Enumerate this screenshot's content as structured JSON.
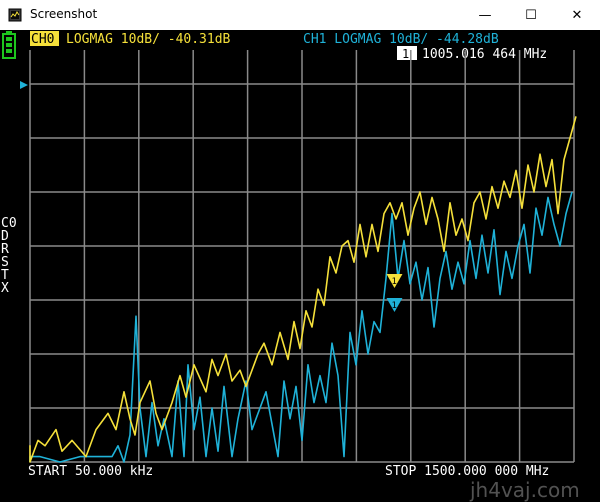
{
  "window": {
    "title": "Screenshot",
    "minimize_glyph": "—",
    "maximize_glyph": "☐",
    "close_glyph": "✕"
  },
  "header": {
    "ch0_tag": "CH0",
    "ch0_info": "LOGMAG 10dB/ -40.31dB",
    "ch1_info": "CH1 LOGMAG 10dB/ -44.28dB",
    "marker_readout": "1005.016 464 MHz",
    "marker_number": "1"
  },
  "side_menu": {
    "items": [
      "C0",
      "D",
      "R",
      "S",
      "T",
      "X"
    ]
  },
  "footer": {
    "start": "START 50.000 kHz",
    "stop": "STOP 1500.000 000 MHz"
  },
  "watermark": "jh4vaj.com",
  "colors": {
    "ch0_trace": "#f5e03a",
    "ch1_trace": "#1fb2d8",
    "grid": "#8a8a8a",
    "battery": "#1ec71e",
    "text": "#ffffff"
  },
  "chart_data": {
    "type": "line",
    "x_start_mhz": 0.05,
    "x_stop_mhz": 1500,
    "y_scale_db_per_div": 10,
    "grid": true,
    "marker": {
      "index": 1,
      "freq_mhz": 1005.016464
    },
    "series": [
      {
        "name": "CH0",
        "color": "#f5e03a",
        "points": [
          [
            3.0,
            7.8
          ],
          [
            12,
            7.9
          ],
          [
            18,
            7.7
          ],
          [
            28,
            8
          ],
          [
            38,
            7.6
          ],
          [
            45,
            7.7
          ],
          [
            56,
            7.4
          ],
          [
            62,
            7.8
          ],
          [
            72,
            7.6
          ],
          [
            86,
            7.9
          ],
          [
            96,
            7.4
          ],
          [
            108,
            7.1
          ],
          [
            116,
            7.4
          ],
          [
            124,
            6.7
          ],
          [
            130,
            7.2
          ],
          [
            135,
            7.5
          ],
          [
            140,
            6.9
          ],
          [
            150,
            6.5
          ],
          [
            156,
            7.1
          ],
          [
            162,
            7.4
          ],
          [
            172,
            6.9
          ],
          [
            180,
            6.4
          ],
          [
            186,
            6.8
          ],
          [
            194,
            6.2
          ],
          [
            206,
            6.7
          ],
          [
            212,
            6.1
          ],
          [
            218,
            6.4
          ],
          [
            226,
            6.0
          ],
          [
            232,
            6.5
          ],
          [
            240,
            6.3
          ],
          [
            246,
            6.6
          ],
          [
            258,
            6.0
          ],
          [
            264,
            5.8
          ],
          [
            272,
            6.2
          ],
          [
            280,
            5.6
          ],
          [
            288,
            6.1
          ],
          [
            294,
            5.4
          ],
          [
            300,
            5.9
          ],
          [
            306,
            5.2
          ],
          [
            312,
            5.5
          ],
          [
            318,
            4.8
          ],
          [
            324,
            5.1
          ],
          [
            330,
            4.2
          ],
          [
            336,
            4.5
          ],
          [
            342,
            4.0
          ],
          [
            348,
            3.9
          ],
          [
            354,
            4.3
          ],
          [
            360,
            3.6
          ],
          [
            366,
            4.2
          ],
          [
            372,
            3.6
          ],
          [
            378,
            4.1
          ],
          [
            384,
            3.4
          ],
          [
            390,
            3.2
          ],
          [
            396,
            3.5
          ],
          [
            402,
            3.2
          ],
          [
            408,
            3.8
          ],
          [
            414,
            3.3
          ],
          [
            420,
            3.0
          ],
          [
            426,
            3.6
          ],
          [
            432,
            3.1
          ],
          [
            438,
            3.5
          ],
          [
            444,
            4.1
          ],
          [
            450,
            3.2
          ],
          [
            456,
            3.8
          ],
          [
            462,
            3.5
          ],
          [
            468,
            3.9
          ],
          [
            474,
            3.2
          ],
          [
            480,
            3.0
          ],
          [
            486,
            3.5
          ],
          [
            492,
            2.9
          ],
          [
            498,
            3.3
          ],
          [
            504,
            2.8
          ],
          [
            510,
            3.1
          ],
          [
            516,
            2.6
          ],
          [
            522,
            3.3
          ],
          [
            528,
            2.5
          ],
          [
            534,
            3.0
          ],
          [
            540,
            2.3
          ],
          [
            546,
            2.9
          ],
          [
            552,
            2.4
          ],
          [
            558,
            3.4
          ],
          [
            564,
            2.4
          ],
          [
            570,
            2.0
          ],
          [
            576,
            1.6
          ]
        ]
      },
      {
        "name": "CH1",
        "color": "#1fb2d8",
        "points": [
          [
            3.0,
            8.0
          ],
          [
            20,
            7.9
          ],
          [
            40,
            7.9
          ],
          [
            60,
            8.0
          ],
          [
            80,
            7.9
          ],
          [
            100,
            7.9
          ],
          [
            112,
            7.9
          ],
          [
            118,
            7.7
          ],
          [
            124,
            8.0
          ],
          [
            130,
            7.5
          ],
          [
            136,
            5.3
          ],
          [
            140,
            7.0
          ],
          [
            146,
            7.9
          ],
          [
            152,
            6.9
          ],
          [
            158,
            7.7
          ],
          [
            164,
            7.2
          ],
          [
            172,
            7.9
          ],
          [
            178,
            6.5
          ],
          [
            184,
            7.9
          ],
          [
            188,
            6.2
          ],
          [
            194,
            7.4
          ],
          [
            200,
            6.8
          ],
          [
            206,
            7.9
          ],
          [
            212,
            7.0
          ],
          [
            218,
            7.8
          ],
          [
            224,
            6.6
          ],
          [
            232,
            7.9
          ],
          [
            238,
            7.2
          ],
          [
            246,
            6.5
          ],
          [
            252,
            7.4
          ],
          [
            260,
            7.0
          ],
          [
            266,
            6.7
          ],
          [
            272,
            7.3
          ],
          [
            278,
            7.9
          ],
          [
            284,
            6.5
          ],
          [
            290,
            7.2
          ],
          [
            296,
            6.6
          ],
          [
            302,
            7.6
          ],
          [
            308,
            6.2
          ],
          [
            314,
            6.9
          ],
          [
            320,
            6.4
          ],
          [
            326,
            6.9
          ],
          [
            332,
            5.8
          ],
          [
            338,
            6.4
          ],
          [
            344,
            7.9
          ],
          [
            350,
            5.6
          ],
          [
            356,
            6.2
          ],
          [
            362,
            5.2
          ],
          [
            368,
            6.0
          ],
          [
            374,
            5.4
          ],
          [
            380,
            5.6
          ],
          [
            386,
            4.6
          ],
          [
            392,
            3.4
          ],
          [
            398,
            4.6
          ],
          [
            404,
            3.9
          ],
          [
            410,
            4.7
          ],
          [
            416,
            4.3
          ],
          [
            422,
            5.0
          ],
          [
            428,
            4.4
          ],
          [
            434,
            5.5
          ],
          [
            440,
            4.6
          ],
          [
            446,
            4.1
          ],
          [
            452,
            4.8
          ],
          [
            458,
            4.3
          ],
          [
            464,
            4.7
          ],
          [
            470,
            3.9
          ],
          [
            476,
            4.6
          ],
          [
            482,
            3.8
          ],
          [
            488,
            4.5
          ],
          [
            494,
            3.7
          ],
          [
            500,
            4.9
          ],
          [
            506,
            4.1
          ],
          [
            512,
            4.6
          ],
          [
            518,
            4.0
          ],
          [
            524,
            3.6
          ],
          [
            530,
            4.5
          ],
          [
            536,
            3.3
          ],
          [
            542,
            3.8
          ],
          [
            548,
            3.1
          ],
          [
            554,
            3.6
          ],
          [
            560,
            4.0
          ],
          [
            566,
            3.4
          ],
          [
            572,
            3.0
          ]
        ]
      }
    ]
  }
}
